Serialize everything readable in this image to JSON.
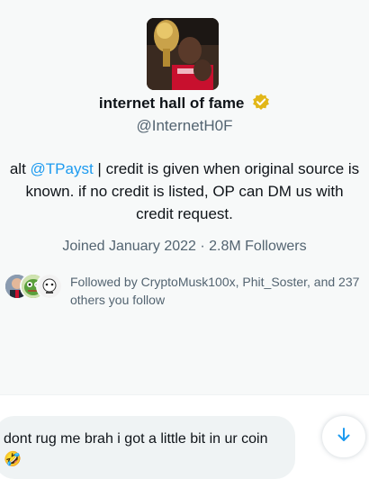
{
  "profile": {
    "name": "internet hall of fame",
    "handle": "@InternetH0F",
    "bio_prefix": "alt ",
    "bio_mention": "@TPayst",
    "bio_rest": " | credit is given when original source is known. if no credit is listed, OP can DM us with credit request.",
    "joined": "Joined January 2022",
    "separator": " · ",
    "followers": "2.8M Followers",
    "followed_by": "Followed by CryptoMusk100x, Phit_Soster, and 237 others you follow"
  },
  "message": {
    "text": "dont rug me brah i got a little bit in ur coin",
    "emoji": "🤣"
  },
  "colors": {
    "accent": "#1d9bf0",
    "verified": "#e2b719",
    "secondary_text": "#536471"
  },
  "icons": {
    "verified": "verified-badge-icon",
    "scroll": "arrow-down-icon"
  }
}
